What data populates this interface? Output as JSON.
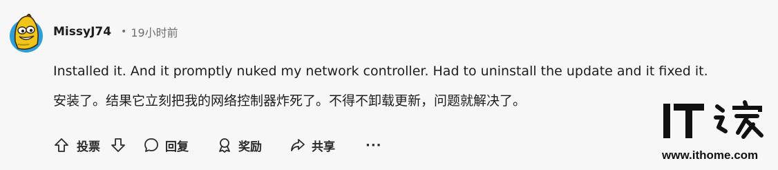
{
  "comment": {
    "username": "MissyJ74",
    "separator": "•",
    "timestamp": "19小时前",
    "text_en": "Installed it. And it promptly nuked my network controller. Had to uninstall the update and it fixed it.",
    "text_zh": "安装了。结果它立刻把我的网络控制器炸死了。不得不卸载更新，问题就解决了。"
  },
  "actions": {
    "upvote_icon": "arrow-up-icon",
    "vote_label": "投票",
    "downvote_icon": "arrow-down-icon",
    "comment_icon": "speech-bubble-icon",
    "reply_label": "回复",
    "award_icon": "award-icon",
    "award_label": "奖励",
    "share_icon": "share-arrow-icon",
    "share_label": "共享",
    "more_label": "···"
  },
  "watermark": {
    "logo_text": "IT之家",
    "url": "www.ithome.com"
  }
}
